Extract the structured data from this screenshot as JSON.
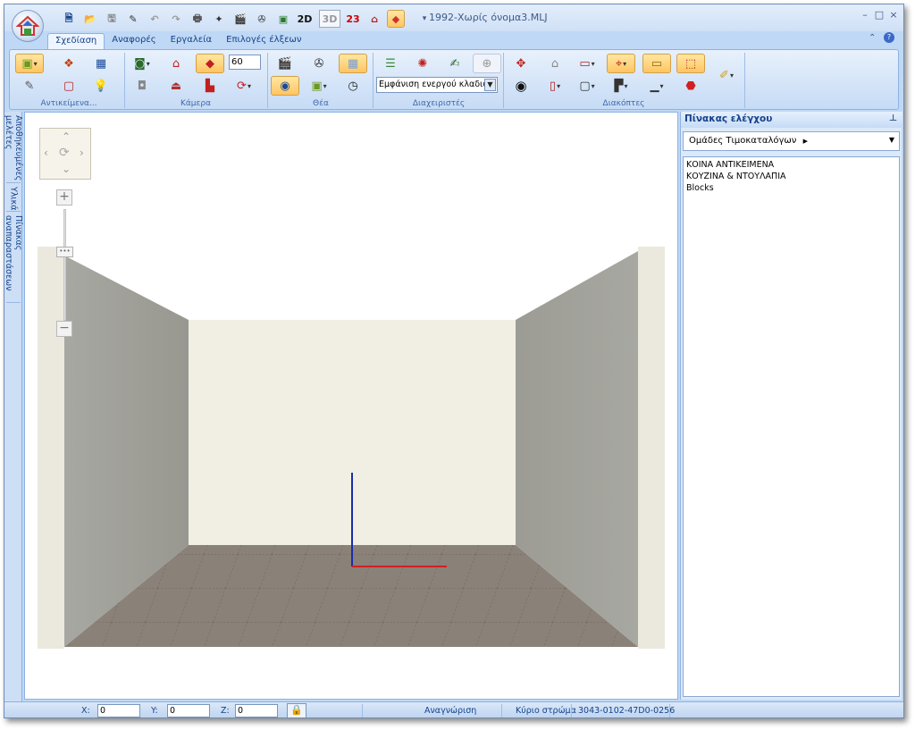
{
  "window": {
    "title": "1992-Χωρίς όνομα3.MLJ",
    "minimize": "–",
    "maximize": "□",
    "close": "×"
  },
  "quick_access": {
    "mode_2d": "2D",
    "mode_3d": "3D",
    "mode_23": "23"
  },
  "tabs": [
    {
      "label": "Σχεδίαση"
    },
    {
      "label": "Αναφορές"
    },
    {
      "label": "Εργαλεία"
    },
    {
      "label": "Επιλογές έλξεων"
    }
  ],
  "ribbon": {
    "groups": [
      {
        "label": "Αντικείμενα..."
      },
      {
        "label": "Κάμερα"
      },
      {
        "label": "Θέα"
      },
      {
        "label": "Διαχειριστές"
      },
      {
        "label": "Διακόπτες"
      }
    ],
    "camera_angle": "60",
    "layer_display": "Εμφάνιση ενεργού κλαδιού"
  },
  "side_tabs": [
    {
      "label": "Αποθηκευμένες μελέτες"
    },
    {
      "label": "Υλικά"
    },
    {
      "label": "Πίνακας αναπαραστάσεων"
    }
  ],
  "panel": {
    "title": "Πίνακας ελέγχου",
    "catalog_dropdown": "Ομάδες Τιμοκαταλόγων",
    "tree": [
      "ΚΟΙΝΑ ΑΝΤΙΚΕΙΜΕΝΑ",
      "ΚΟΥΖΙΝΑ & ΝΤΟΥΛΑΠΙΑ",
      "Blocks"
    ]
  },
  "statusbar": {
    "x_label": "X:",
    "x_value": "0",
    "y_label": "Y:",
    "y_value": "0",
    "z_label": "Z:",
    "z_value": "0",
    "recognition": "Αναγνώριση",
    "layer_label": "Κύριο στρώμα",
    "code": "3043-0102-47D0-0256"
  },
  "colors": {
    "accent": "#15428b",
    "wall_back": "#f2f0e6",
    "wall_side": "#a7a7a1",
    "floor": "#8a8179",
    "axis_z": "#1a2da8",
    "axis_x": "#d22020"
  }
}
